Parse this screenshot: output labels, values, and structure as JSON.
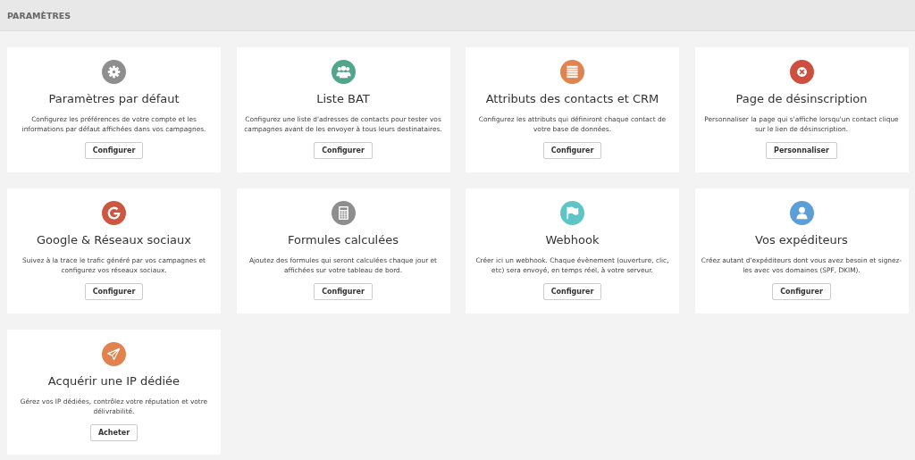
{
  "header": {
    "title": "PARAMÈTRES"
  },
  "cards": [
    {
      "kind": "gear",
      "color": "#8e8e8e",
      "title": "Paramètres par défaut",
      "description": "Configurez les préférences de votre compte et les informations par défaut affichées dans vos campagnes.",
      "button": "Configurer"
    },
    {
      "kind": "users",
      "color": "#4fa68c",
      "title": "Liste BAT",
      "description": "Configurez une liste d'adresses de contacts pour tester vos campagnes avant de les envoyer à tous leurs destinataires.",
      "button": "Configurer"
    },
    {
      "kind": "list",
      "color": "#e0834f",
      "title": "Attributs des contacts et CRM",
      "description": "Configurez les attributs qui définiront chaque contact de votre base de données.",
      "button": "Configurer"
    },
    {
      "kind": "close",
      "color": "#cc4f3f",
      "title": "Page de désinscription",
      "description": "Personnaliser la page qui s'affiche lorsqu'un contact clique sur le lien de désinscription.",
      "button": "Personnaliser"
    },
    {
      "kind": "g",
      "color": "#cc5640",
      "title": "Google & Réseaux sociaux",
      "description": "Suivez à la trace le trafic généré par vos campagnes et configurez vos réseaux sociaux.",
      "button": "Configurer"
    },
    {
      "kind": "calculator",
      "color": "#8e8e8e",
      "title": "Formules calculées",
      "description": "Ajoutez des formules qui seront calculées chaque jour et affichées sur votre tableau de bord.",
      "button": "Configurer"
    },
    {
      "kind": "flag",
      "color": "#5fc4c6",
      "title": "Webhook",
      "description": "Créer ici un webhook. Chaque évènement (ouverture, clic, etc) sera envoyé, en temps réel, à votre serveur.",
      "button": "Configurer"
    },
    {
      "kind": "user",
      "color": "#5b9ed8",
      "title": "Vos expéditeurs",
      "description": "Créez autant d'expéditeurs dont vous avez besoin et signez-les avec vos domaines (SPF, DKIM).",
      "button": "Configurer"
    },
    {
      "kind": "plane",
      "color": "#e0834f",
      "title": "Acquérir une IP dédiée",
      "description": "Gérez vos IP dédiées, contrôlez votre réputation et votre délivrabilité.",
      "button": "Acheter"
    }
  ]
}
